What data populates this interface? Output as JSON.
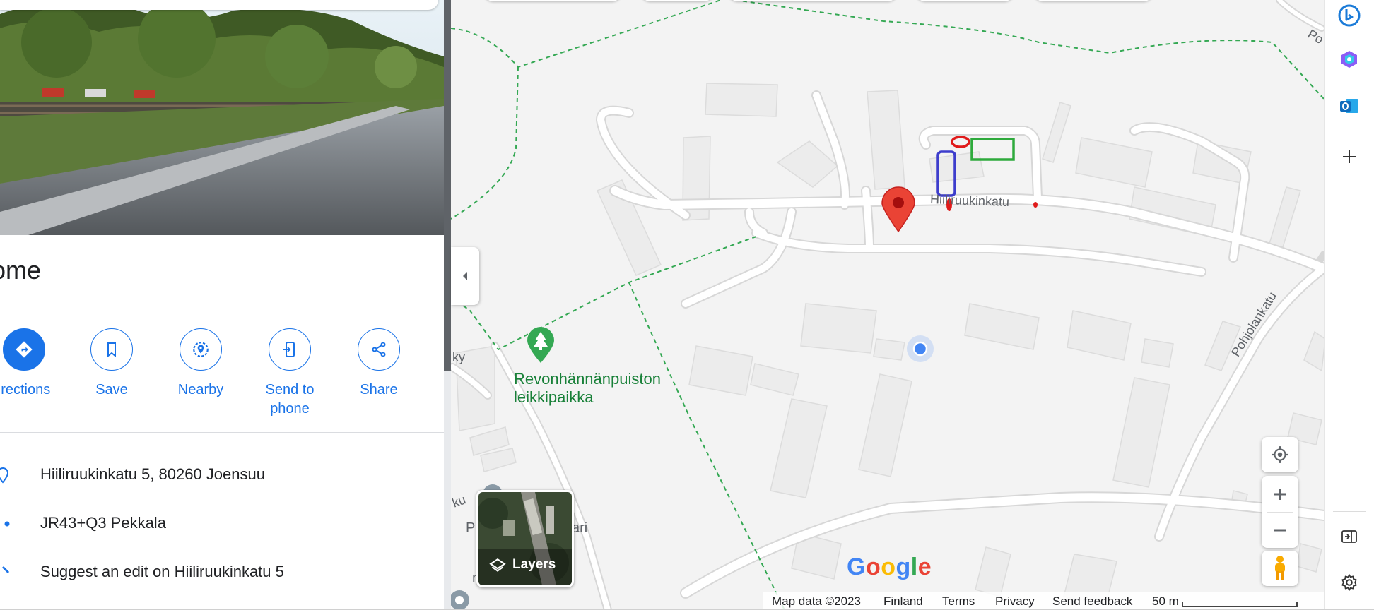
{
  "place": {
    "title": "ome"
  },
  "actions": [
    {
      "label": "irections",
      "icon": "directions-icon"
    },
    {
      "label": "Save",
      "icon": "bookmark-icon"
    },
    {
      "label": "Nearby",
      "icon": "nearby-icon"
    },
    {
      "label": "Send to\nphone",
      "icon": "send-to-phone-icon"
    },
    {
      "label": "Share",
      "icon": "share-icon"
    }
  ],
  "info": [
    {
      "text": "Hiiliruukinkatu 5, 80260 Joensuu",
      "icon": "location-pin-icon"
    },
    {
      "text": "JR43+Q3 Pekkala",
      "icon": "plus-code-icon"
    },
    {
      "text": "Suggest an edit on Hiiliruukinkatu 5",
      "icon": "edit-icon"
    }
  ],
  "map": {
    "street_label": "Hiiliruukinkatu",
    "street_label_2": "Pohjolankatu",
    "edge_label_top": "Po",
    "park_label_line1": "Revonhännänpuiston",
    "park_label_line2": "leikkipaikka",
    "left_fragments": [
      "ky",
      "ku",
      "P",
      "ari",
      "nixr"
    ],
    "layers_label": "Layers",
    "google_logo": "Google"
  },
  "footer": {
    "map_data": "Map data ©2023",
    "country": "Finland",
    "terms": "Terms",
    "privacy": "Privacy",
    "feedback": "Send feedback",
    "scale": "50 m"
  },
  "colors": {
    "accent": "#1a73e8",
    "park_green": "#188038",
    "marker_red": "#ea4335"
  }
}
